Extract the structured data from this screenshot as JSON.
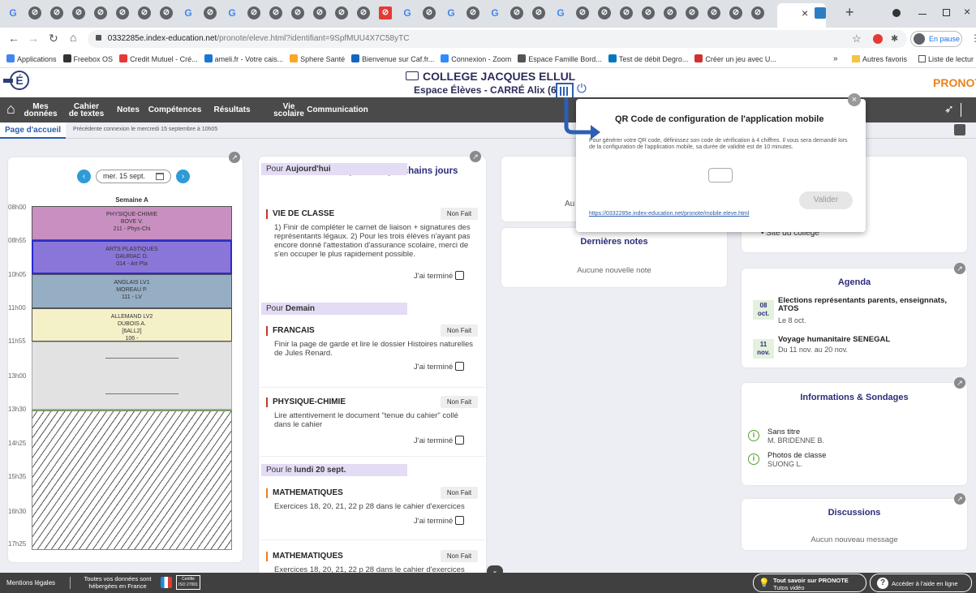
{
  "browser": {
    "tab_close": "×",
    "new_tab": "+",
    "url_host": "0332285e.index-education.net",
    "url_path": "/pronote/eleve.html?identifiant=9SpfMUU4X7C58yTC",
    "profile_status": "En pause",
    "bookmarks": [
      {
        "label": "Applications",
        "color": "#4285f4"
      },
      {
        "label": "Freebox OS",
        "color": "#333333"
      },
      {
        "label": "Credit Mutuel - Cré...",
        "color": "#e53935"
      },
      {
        "label": "ameli.fr - Votre cais...",
        "color": "#1976d2"
      },
      {
        "label": "Sphere Santé",
        "color": "#f9a825"
      },
      {
        "label": "Bienvenue sur Caf.fr...",
        "color": "#1565c0"
      },
      {
        "label": "Connexion - Zoom",
        "color": "#2d8cff"
      },
      {
        "label": "Espace Famille Bord...",
        "color": "#555555"
      },
      {
        "label": "Test de débit Degro...",
        "color": "#0277bd"
      },
      {
        "label": "Créer un jeu avec U...",
        "color": "#d32f2f"
      }
    ],
    "other_bookmarks": "Autres favoris",
    "reading_list": "Liste de lectur"
  },
  "app": {
    "school_name": "COLLEGE JACQUES ELLUL",
    "space_label": "Espace Élèves - CARRÉ Alix (6B)",
    "brand": "PRONOT",
    "nav": [
      {
        "label": "Mes données"
      },
      {
        "label": "Cahier\nde textes"
      },
      {
        "label": "Notes"
      },
      {
        "label": "Compétences"
      },
      {
        "label": "Résultats"
      },
      {
        "label": "Vie\nscolaire"
      },
      {
        "label": "Communication"
      }
    ],
    "home_tab": "Page d'accueil",
    "last_connection": "Précédente connexion le mercredi 15 septembre à 10h05"
  },
  "timetable": {
    "date": "mer. 15 sept.",
    "week": "Semaine A",
    "hours": [
      "08h00",
      "08h55",
      "10h05",
      "11h00",
      "11h55",
      "13h00",
      "13h30",
      "14h25",
      "15h35",
      "16h30",
      "17h25"
    ],
    "lessons": [
      {
        "subject": "PHYSIQUE-CHIMIE",
        "teacher": "BOVE V.",
        "room": "211 - Phys-Chi",
        "color": "#c98fc0"
      },
      {
        "subject": "ARTS PLASTIQUES",
        "teacher": "DAURIAC D.",
        "room": "014 - Art Pla",
        "color": "#8a76d8"
      },
      {
        "subject": "ANGLAIS LV1",
        "teacher": "MOREAU P.",
        "room": "111 - LV",
        "color": "#95aec4"
      },
      {
        "subject": "ALLEMAND LV2",
        "teacher": "DUBOIS A.",
        "group": "[6ALL2]",
        "room": "106 -",
        "color": "#f4f0c8"
      }
    ]
  },
  "homework": {
    "title": "Travail à faire pour les prochains jours",
    "groups": [
      {
        "prefix": "Pour ",
        "when": "Aujourd'hui"
      },
      {
        "prefix": "Pour ",
        "when": "Demain"
      },
      {
        "prefix": "Pour le ",
        "when": "lundi 20 sept."
      }
    ],
    "status": "Non Fait",
    "done_label": "J'ai terminé",
    "tasks": [
      {
        "subject": "VIE DE CLASSE",
        "text": "1) Finir de compléter le carnet de liaison + signatures des représentants légaux. 2) Pour les trois élèves n'ayant pas encore donné l'attestation d'assurance scolaire, merci de s'en occuper le plus rapidement possible."
      },
      {
        "subject": "FRANCAIS",
        "text": "Finir la page de garde et lire le dossier Histoires naturelles de Jules Renard."
      },
      {
        "subject": "PHYSIQUE-CHIMIE",
        "text": "Lire attentivement le document \"tenue du cahier\" collé dans le cahier"
      },
      {
        "subject": "MATHEMATIQUES",
        "text": "Exercices 18, 20, 21, 22 p 28 dans le cahier d'exercices"
      },
      {
        "subject": "MATHEMATIQUES",
        "text": "Exercices 18, 20, 21, 22 p 28 dans le cahier d'exercices"
      }
    ]
  },
  "grades": {
    "partial_text": "Au",
    "title": "Dernières notes",
    "empty": "Aucune nouvelle note"
  },
  "links": {
    "partial_title": "les",
    "site": "Site du collège"
  },
  "agenda": {
    "title": "Agenda",
    "events": [
      {
        "day": "08",
        "month": "oct.",
        "title": "Elections représentants parents, enseignnats, ATOS",
        "date": "Le 8 oct."
      },
      {
        "day": "11",
        "month": "nov.",
        "title": "Voyage humanitaire SENEGAL",
        "date": "Du 11 nov. au 20 nov."
      }
    ]
  },
  "info": {
    "title": "Informations & Sondages",
    "items": [
      {
        "title": "Sans titre",
        "author": "M. BRIDENNE B."
      },
      {
        "title": "Photos de classe",
        "author": "SUONG L."
      }
    ]
  },
  "discussions": {
    "title": "Discussions",
    "empty": "Aucun nouveau message"
  },
  "qr_popup": {
    "title": "QR Code de configuration de l'application mobile",
    "text": "Pour générer votre QR code, définissez son code de vérification à 4 chiffres. Il vous sera demandé lors de la configuration de l'application mobile, sa durée de validité est de 10 minutes.",
    "validate": "Valider",
    "link": "https://0332285e.index-education.net/pronote/mobile.eleve.html"
  },
  "footer": {
    "legal": "Mentions légales",
    "hosting": "Toutes vos données sont\nhébergées en France",
    "cert": "Certifié\nISO 27001",
    "tutos_title": "Tout savoir sur PRONOTE",
    "tutos_sub": "Tutos vidéo",
    "help": "Accéder à l'aide en ligne"
  }
}
